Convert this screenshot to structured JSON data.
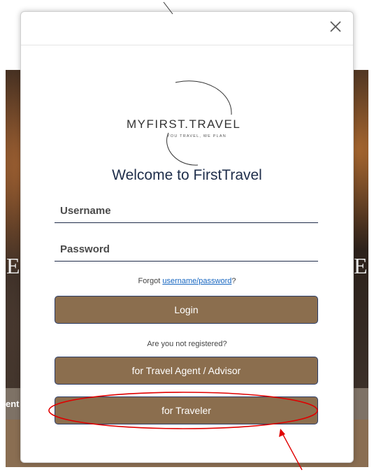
{
  "background": {
    "left_letter": "E",
    "right_letter": "E",
    "side_text": "ent"
  },
  "modal": {
    "close_icon": "close-icon",
    "logo": {
      "title": "MYFIRST.TRAVEL",
      "tagline": "YOU TRAVEL, WE PLAN"
    },
    "welcome": "Welcome to FirstTravel",
    "username_placeholder": "Username",
    "password_placeholder": "Password",
    "forgot_prefix": "Forgot ",
    "forgot_link": "username/password",
    "forgot_suffix": "?",
    "login_label": "Login",
    "not_registered": "Are you not registered?",
    "agent_button": "for Travel Agent / Advisor",
    "traveler_button": "for Traveler"
  },
  "colors": {
    "button_bg": "#8b6e4e",
    "button_border": "#2c3e69",
    "link": "#1565c0",
    "annotation": "#e00000"
  }
}
